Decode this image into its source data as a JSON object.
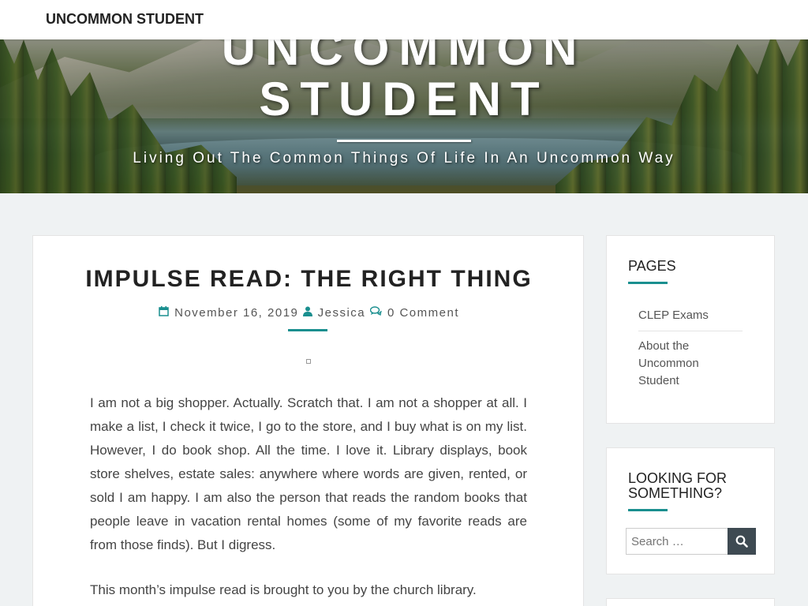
{
  "header": {
    "brand": "UNCOMMON STUDENT"
  },
  "hero": {
    "title_line1": "UNCOMMON",
    "title_line2": "STUDENT",
    "tagline": "Living Out The Common Things Of Life In An Uncommon Way"
  },
  "post": {
    "title": "IMPULSE READ: THE RIGHT THING",
    "date": "November 16, 2019",
    "author": "Jessica",
    "comments": "0 Comment",
    "paragraph1": "I am not a big shopper. Actually. Scratch that. I am not a shopper at all. I make a list, I check it twice, I go to the store, and I buy what is on my list. However, I do book shop. All the time. I love it. Library displays, book store shelves, estate sales: anywhere where words are given, rented, or sold I am happy. I am also the person that reads the random books that people leave in vacation rental homes (some of my favorite reads are from those finds). But I digress.",
    "paragraph2": "This month’s impulse read is brought to you by the church library."
  },
  "sidebar": {
    "pages_title": "PAGES",
    "pages": [
      {
        "label": "CLEP Exams"
      },
      {
        "label": "About the Uncommon Student"
      }
    ],
    "search_title": "LOOKING FOR SOMETHING?",
    "search_placeholder": "Search …"
  },
  "colors": {
    "accent": "#1a8f8f",
    "search_button": "#3e4a52",
    "background": "#eff2f3"
  },
  "icons": {
    "date": "calendar-icon",
    "author": "user-icon",
    "comments": "comments-icon",
    "search": "search-icon"
  }
}
